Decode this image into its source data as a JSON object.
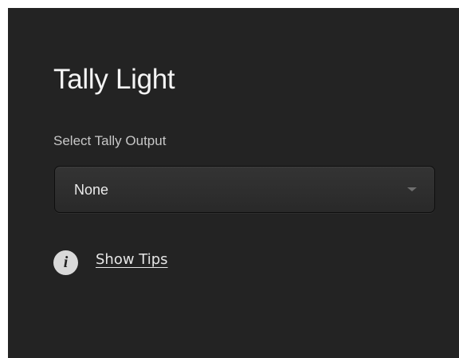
{
  "panel": {
    "title": "Tally Light",
    "tally_output": {
      "label": "Select Tally Output",
      "selected": "None"
    },
    "tips": {
      "icon": "info-icon",
      "label": "Show Tips"
    }
  },
  "colors": {
    "background": "#232323",
    "text": "#f4f4f4",
    "control": "#2e2e2e"
  }
}
